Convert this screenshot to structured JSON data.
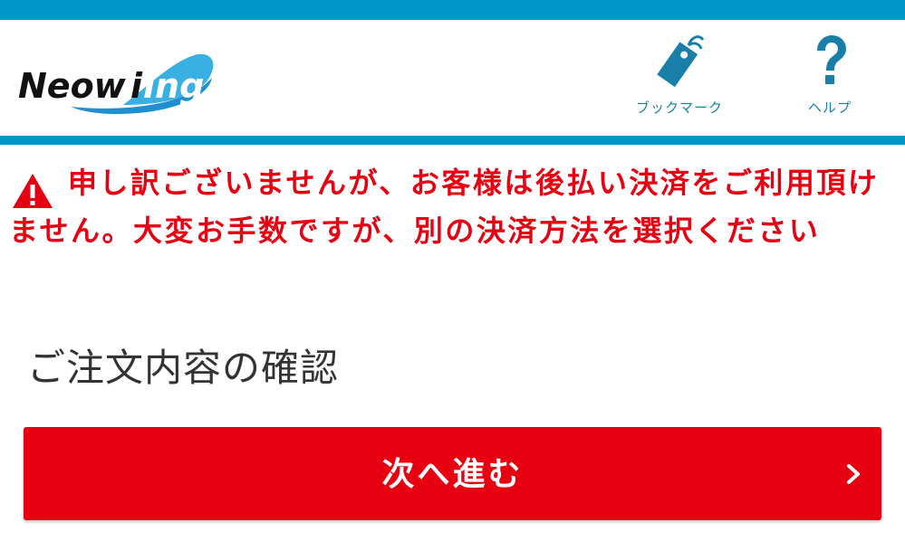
{
  "header": {
    "logo_text_dark": "Neow",
    "logo_text_light": "ing",
    "logo_text_i": "i",
    "actions": [
      {
        "label": "ブックマーク",
        "icon": "bookmark-tag-icon"
      },
      {
        "label": "ヘルプ",
        "icon": "question-icon"
      }
    ]
  },
  "error": {
    "icon": "warning-triangle-icon",
    "message": "申し訳ございませんが、お客様は後払い決済をご利用頂けません。大変お手数ですが、別の決済方法を選択ください"
  },
  "main": {
    "title": "ご注文内容の確認",
    "next_button_label": "次へ進む",
    "next_button_icon": "chevron-right-icon"
  },
  "colors": {
    "brand_blue": "#0096c7",
    "error_red": "#e60012",
    "logo_light_blue": "#3ab0e2"
  }
}
